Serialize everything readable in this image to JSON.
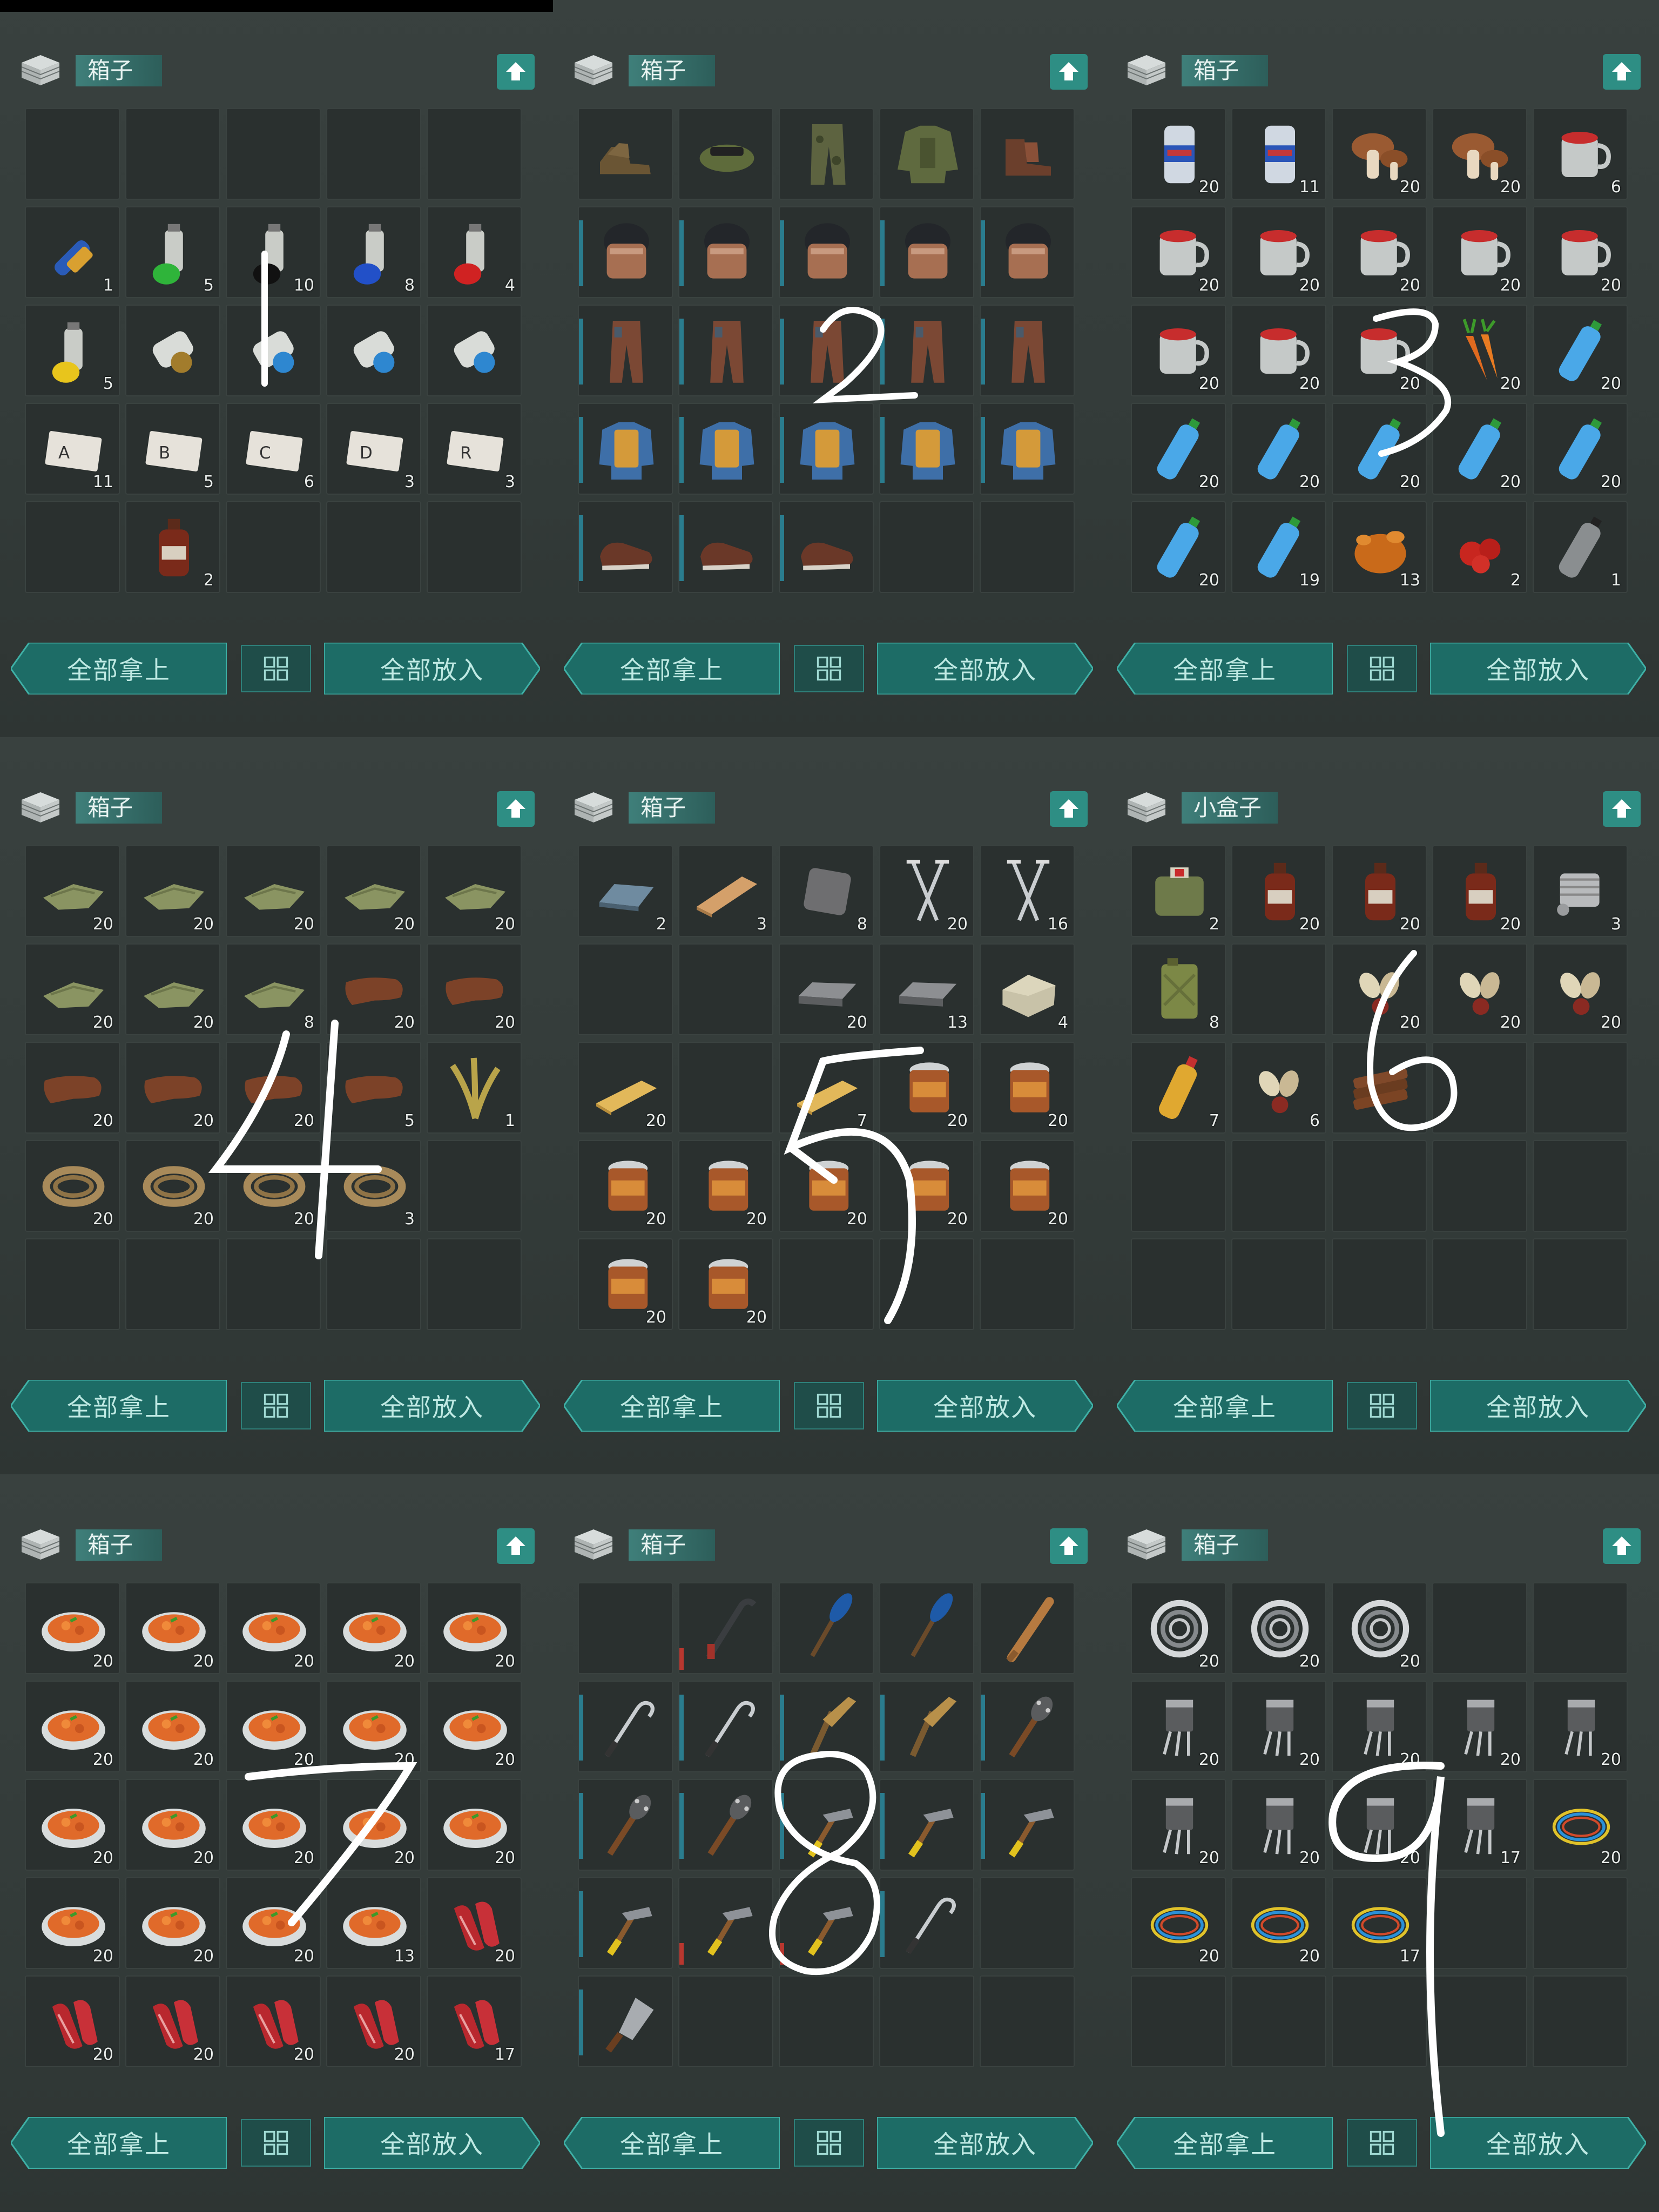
{
  "buttons": {
    "take_all": "全部拿上",
    "put_all": "全部放入"
  },
  "icons": {
    "box": "box-icon",
    "upload": "upload-arrow-icon",
    "sort": "sort-grid-icon"
  },
  "colors": {
    "accent": "#2e8e84",
    "title_bg": "#3f7f7a",
    "slot_bg": "#2a302f",
    "count_text": "#e8ecea"
  },
  "annotations": [
    "1",
    "2",
    "3",
    "4",
    "5",
    "6",
    "7",
    "8",
    "9"
  ],
  "panels": [
    {
      "title": "箱子",
      "rows": 5,
      "slots": [
        {
          "item": "empty"
        },
        {
          "item": "empty"
        },
        {
          "item": "empty"
        },
        {
          "item": "empty"
        },
        {
          "item": "empty"
        },
        {
          "item": "blue-shell",
          "count": "1"
        },
        {
          "item": "green-spray",
          "count": "5"
        },
        {
          "item": "black-spray",
          "count": "10"
        },
        {
          "item": "blue-spray",
          "count": "8"
        },
        {
          "item": "red-spray",
          "count": "4"
        },
        {
          "item": "yellow-spray",
          "count": "5"
        },
        {
          "item": "grenade-brass",
          "count": ""
        },
        {
          "item": "grenade-blue",
          "count": ""
        },
        {
          "item": "grenade-blue",
          "count": ""
        },
        {
          "item": "grenade-blue",
          "count": ""
        },
        {
          "item": "card-A",
          "count": "11"
        },
        {
          "item": "card-B",
          "count": "5"
        },
        {
          "item": "card-C",
          "count": "6"
        },
        {
          "item": "card-D",
          "count": "3"
        },
        {
          "item": "card-R",
          "count": "3"
        },
        {
          "item": "empty"
        },
        {
          "item": "bottle",
          "count": "2"
        },
        {
          "item": "empty"
        },
        {
          "item": "empty"
        },
        {
          "item": "empty"
        }
      ]
    },
    {
      "title": "箱子",
      "rows": 5,
      "slots": [
        {
          "item": "boots"
        },
        {
          "item": "cap"
        },
        {
          "item": "camo-pants"
        },
        {
          "item": "camo-jacket"
        },
        {
          "item": "boots-brown"
        },
        {
          "item": "helmet",
          "bar": true
        },
        {
          "item": "helmet",
          "bar": true
        },
        {
          "item": "helmet",
          "bar": true
        },
        {
          "item": "helmet",
          "bar": true
        },
        {
          "item": "helmet",
          "bar": true
        },
        {
          "item": "leather-pants",
          "bar": true
        },
        {
          "item": "leather-pants",
          "bar": true
        },
        {
          "item": "leather-pants",
          "bar": true
        },
        {
          "item": "leather-pants",
          "bar": true
        },
        {
          "item": "leather-pants",
          "bar": true
        },
        {
          "item": "vest",
          "bar": true
        },
        {
          "item": "vest",
          "bar": true
        },
        {
          "item": "vest",
          "bar": true
        },
        {
          "item": "vest",
          "bar": true
        },
        {
          "item": "vest",
          "bar": true
        },
        {
          "item": "shoes",
          "bar": true
        },
        {
          "item": "shoes",
          "bar": true
        },
        {
          "item": "shoes",
          "bar": true
        },
        {
          "item": "empty"
        },
        {
          "item": "empty"
        }
      ]
    },
    {
      "title": "箱子",
      "rows": 5,
      "slots": [
        {
          "item": "beer-can",
          "count": "20"
        },
        {
          "item": "beer-can",
          "count": "11"
        },
        {
          "item": "mushroom",
          "count": "20"
        },
        {
          "item": "mushroom",
          "count": "20"
        },
        {
          "item": "mug",
          "count": "6"
        },
        {
          "item": "mug",
          "count": "20"
        },
        {
          "item": "mug",
          "count": "20"
        },
        {
          "item": "mug",
          "count": "20"
        },
        {
          "item": "mug",
          "count": "20"
        },
        {
          "item": "mug",
          "count": "20"
        },
        {
          "item": "mug",
          "count": "20"
        },
        {
          "item": "mug",
          "count": "20"
        },
        {
          "item": "mug",
          "count": "20"
        },
        {
          "item": "carrot",
          "count": "20"
        },
        {
          "item": "water-bottle",
          "count": "20"
        },
        {
          "item": "water-bottle",
          "count": "20"
        },
        {
          "item": "water-bottle",
          "count": "20"
        },
        {
          "item": "water-bottle",
          "count": "20"
        },
        {
          "item": "water-bottle",
          "count": "20"
        },
        {
          "item": "water-bottle",
          "count": "20"
        },
        {
          "item": "water-bottle",
          "count": "20"
        },
        {
          "item": "water-bottle",
          "count": "19"
        },
        {
          "item": "roast-chicken",
          "count": "13"
        },
        {
          "item": "berries",
          "count": "2"
        },
        {
          "item": "empty-bottle",
          "count": "1"
        }
      ]
    },
    {
      "title": "箱子",
      "rows": 5,
      "slots": [
        {
          "item": "cloth",
          "count": "20"
        },
        {
          "item": "cloth",
          "count": "20"
        },
        {
          "item": "cloth",
          "count": "20"
        },
        {
          "item": "cloth",
          "count": "20"
        },
        {
          "item": "cloth",
          "count": "20"
        },
        {
          "item": "cloth",
          "count": "20"
        },
        {
          "item": "cloth",
          "count": "20"
        },
        {
          "item": "cloth",
          "count": "8"
        },
        {
          "item": "leather",
          "count": "20"
        },
        {
          "item": "leather",
          "count": "20"
        },
        {
          "item": "leather",
          "count": "20"
        },
        {
          "item": "leather",
          "count": "20"
        },
        {
          "item": "leather",
          "count": "20"
        },
        {
          "item": "leather",
          "count": "5"
        },
        {
          "item": "plant-fiber",
          "count": "1"
        },
        {
          "item": "rope",
          "count": "20"
        },
        {
          "item": "rope",
          "count": "20"
        },
        {
          "item": "rope",
          "count": "20"
        },
        {
          "item": "rope",
          "count": "3"
        },
        {
          "item": "empty"
        },
        {
          "item": "empty"
        },
        {
          "item": "empty"
        },
        {
          "item": "empty"
        },
        {
          "item": "empty"
        },
        {
          "item": "empty"
        }
      ]
    },
    {
      "title": "箱子",
      "rows": 5,
      "slots": [
        {
          "item": "iron-ingot",
          "count": "2"
        },
        {
          "item": "plank",
          "count": "3"
        },
        {
          "item": "metal-plate",
          "count": "8"
        },
        {
          "item": "nails",
          "count": "20"
        },
        {
          "item": "nails",
          "count": "16"
        },
        {
          "item": "empty"
        },
        {
          "item": "empty"
        },
        {
          "item": "iron-bar",
          "count": "20"
        },
        {
          "item": "iron-bar",
          "count": "13"
        },
        {
          "item": "stone-block",
          "count": "4"
        },
        {
          "item": "wood-plank",
          "count": "20"
        },
        {
          "item": "empty"
        },
        {
          "item": "wood-plank",
          "count": "7"
        },
        {
          "item": "tin-can",
          "count": "20"
        },
        {
          "item": "tin-can",
          "count": "20"
        },
        {
          "item": "tin-can",
          "count": "20"
        },
        {
          "item": "tin-can",
          "count": "20"
        },
        {
          "item": "tin-can",
          "count": "20"
        },
        {
          "item": "tin-can",
          "count": "20"
        },
        {
          "item": "tin-can",
          "count": "20"
        },
        {
          "item": "tin-can",
          "count": "20"
        },
        {
          "item": "tin-can",
          "count": "20"
        },
        {
          "item": "empty"
        },
        {
          "item": "empty"
        },
        {
          "item": "empty"
        }
      ]
    },
    {
      "title": "小盒子",
      "rows": 5,
      "slots": [
        {
          "item": "first-aid-bag",
          "count": "2"
        },
        {
          "item": "bottle",
          "count": "20"
        },
        {
          "item": "bottle",
          "count": "20"
        },
        {
          "item": "bottle",
          "count": "20"
        },
        {
          "item": "engine-part",
          "count": "3"
        },
        {
          "item": "jerry-can",
          "count": "8"
        },
        {
          "item": "empty"
        },
        {
          "item": "seeds",
          "count": "20"
        },
        {
          "item": "seeds",
          "count": "20"
        },
        {
          "item": "seeds",
          "count": "20"
        },
        {
          "item": "oil-bottle",
          "count": "7"
        },
        {
          "item": "seeds",
          "count": "6"
        },
        {
          "item": "wood-pile",
          "count": ""
        },
        {
          "item": "empty"
        },
        {
          "item": "empty"
        },
        {
          "item": "empty"
        },
        {
          "item": "empty"
        },
        {
          "item": "empty"
        },
        {
          "item": "empty"
        },
        {
          "item": "empty"
        },
        {
          "item": "empty"
        },
        {
          "item": "empty"
        },
        {
          "item": "empty"
        },
        {
          "item": "empty"
        },
        {
          "item": "empty"
        }
      ]
    },
    {
      "title": "箱子",
      "rows": 5,
      "slots": [
        {
          "item": "stew",
          "count": "20"
        },
        {
          "item": "stew",
          "count": "20"
        },
        {
          "item": "stew",
          "count": "20"
        },
        {
          "item": "stew",
          "count": "20"
        },
        {
          "item": "stew",
          "count": "20"
        },
        {
          "item": "stew",
          "count": "20"
        },
        {
          "item": "stew",
          "count": "20"
        },
        {
          "item": "stew",
          "count": "20"
        },
        {
          "item": "stew",
          "count": "20"
        },
        {
          "item": "stew",
          "count": "20"
        },
        {
          "item": "stew",
          "count": "20"
        },
        {
          "item": "stew",
          "count": "20"
        },
        {
          "item": "stew",
          "count": "20"
        },
        {
          "item": "stew",
          "count": "20"
        },
        {
          "item": "stew",
          "count": "20"
        },
        {
          "item": "stew",
          "count": "20"
        },
        {
          "item": "stew",
          "count": "20"
        },
        {
          "item": "stew",
          "count": "20"
        },
        {
          "item": "stew",
          "count": "13"
        },
        {
          "item": "raw-meat",
          "count": "20"
        },
        {
          "item": "raw-meat",
          "count": "20"
        },
        {
          "item": "raw-meat",
          "count": "20"
        },
        {
          "item": "raw-meat",
          "count": "20"
        },
        {
          "item": "raw-meat",
          "count": "20"
        },
        {
          "item": "raw-meat",
          "count": "17"
        }
      ]
    },
    {
      "title": "箱子",
      "rows": 5,
      "slots": [
        {
          "item": "empty"
        },
        {
          "item": "crowbar",
          "bar": "red"
        },
        {
          "item": "paddle"
        },
        {
          "item": "paddle"
        },
        {
          "item": "bat"
        },
        {
          "item": "hook",
          "bar": true
        },
        {
          "item": "hook",
          "bar": true
        },
        {
          "item": "plank-club",
          "bar": true
        },
        {
          "item": "plank-club",
          "bar": true
        },
        {
          "item": "spiked-club",
          "bar": true
        },
        {
          "item": "spiked-club",
          "bar": true
        },
        {
          "item": "spiked-club",
          "bar": true
        },
        {
          "item": "hammer",
          "bar": true
        },
        {
          "item": "hammer",
          "bar": true
        },
        {
          "item": "hammer",
          "bar": true
        },
        {
          "item": "hammer",
          "bar": true
        },
        {
          "item": "hammer",
          "bar": "red"
        },
        {
          "item": "hammer",
          "bar": "red"
        },
        {
          "item": "hook",
          "bar": true
        },
        {
          "item": "empty"
        },
        {
          "item": "cleaver",
          "bar": true
        },
        {
          "item": "empty"
        },
        {
          "item": "empty"
        },
        {
          "item": "empty"
        },
        {
          "item": "empty"
        }
      ]
    },
    {
      "title": "箱子",
      "rows": 5,
      "slots": [
        {
          "item": "bearing",
          "count": "20"
        },
        {
          "item": "bearing",
          "count": "20"
        },
        {
          "item": "bearing",
          "count": "20"
        },
        {
          "item": "empty"
        },
        {
          "item": "empty"
        },
        {
          "item": "transistor",
          "count": "20"
        },
        {
          "item": "transistor",
          "count": "20"
        },
        {
          "item": "transistor",
          "count": "20"
        },
        {
          "item": "transistor",
          "count": "20"
        },
        {
          "item": "transistor",
          "count": "20"
        },
        {
          "item": "transistor",
          "count": "20"
        },
        {
          "item": "transistor",
          "count": "20"
        },
        {
          "item": "transistor",
          "count": "20"
        },
        {
          "item": "transistor",
          "count": "17"
        },
        {
          "item": "wire",
          "count": "20"
        },
        {
          "item": "wire",
          "count": "20"
        },
        {
          "item": "wire",
          "count": "20"
        },
        {
          "item": "wire",
          "count": "17"
        },
        {
          "item": "empty"
        },
        {
          "item": "empty"
        },
        {
          "item": "empty"
        },
        {
          "item": "empty"
        },
        {
          "item": "empty"
        },
        {
          "item": "empty"
        },
        {
          "item": "empty"
        }
      ]
    }
  ]
}
